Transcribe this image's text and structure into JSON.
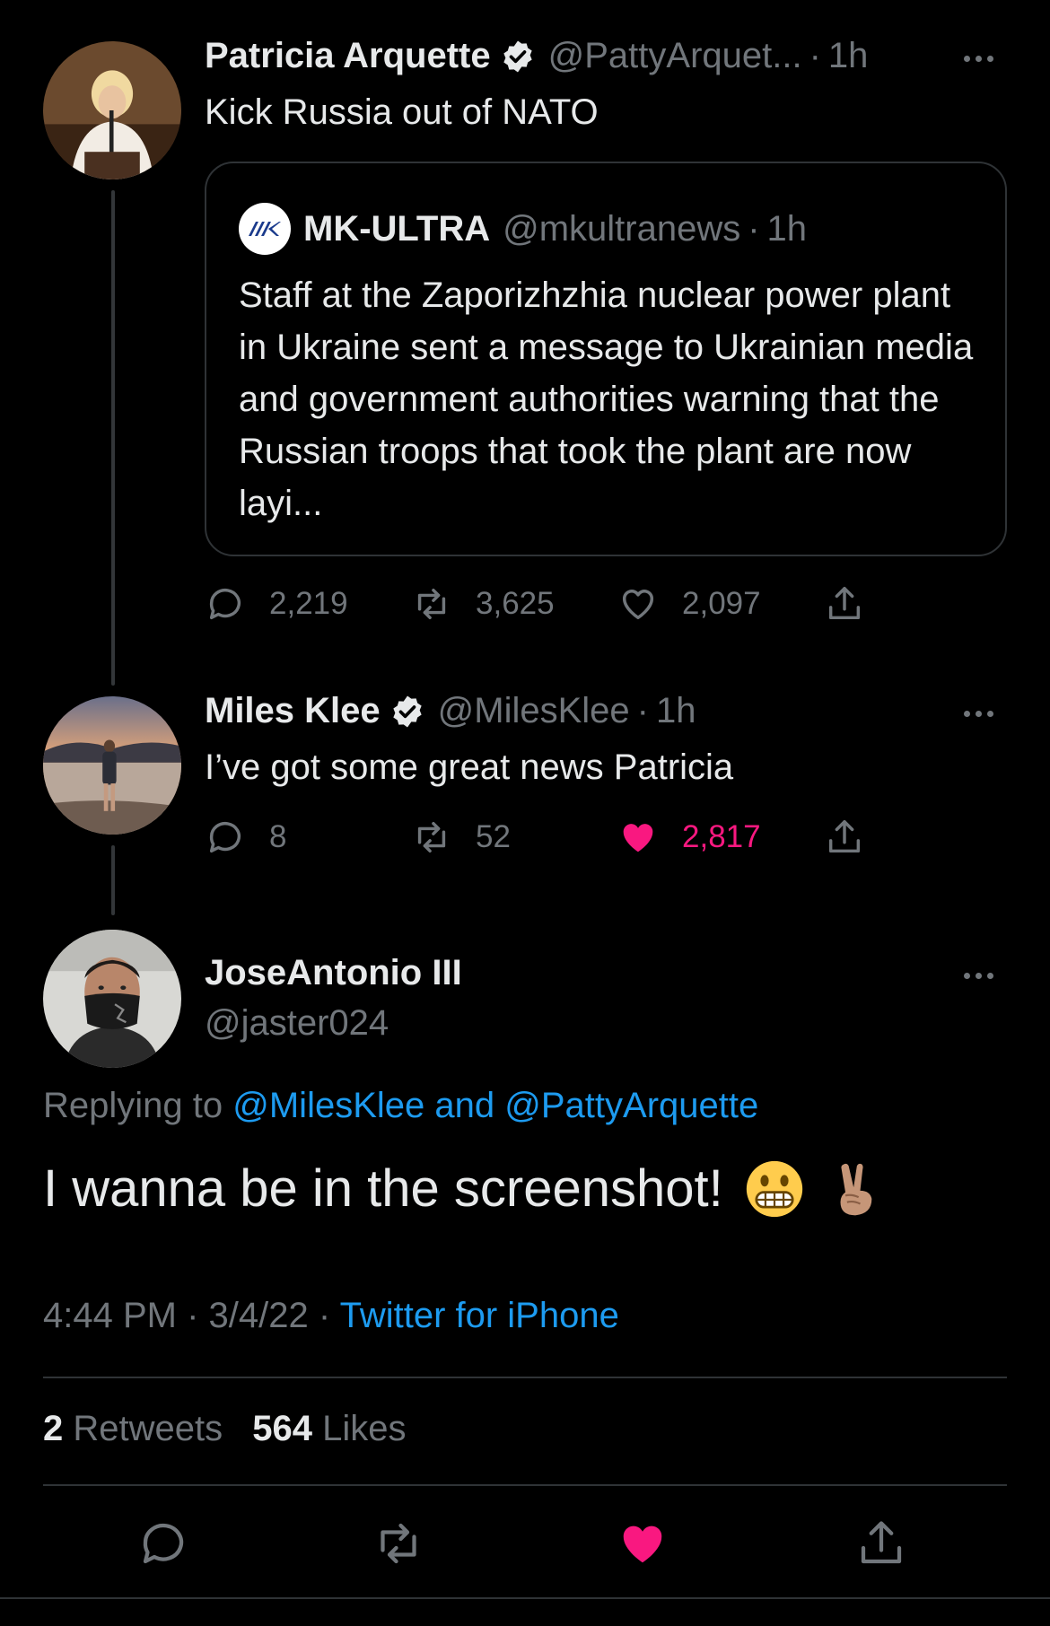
{
  "thread": {
    "tweet1": {
      "name": "Patricia Arquette",
      "handle": "@PattyArquet...",
      "time": "1h",
      "text": "Kick Russia out of NATO",
      "quote": {
        "name": "MK-ULTRA",
        "handle": "@mkultranews",
        "time": "1h",
        "text": "Staff at the Zaporizhzhia nuclear power plant in Ukraine sent a message to Ukrainian media and government authorities warning that the Russian troops that took the plant are now layi..."
      },
      "replies": "2,219",
      "retweets": "3,625",
      "likes": "2,097"
    },
    "tweet2": {
      "name": "Miles Klee",
      "handle": "@MilesKlee",
      "time": "1h",
      "text": "I’ve got some great news Patricia",
      "replies": "8",
      "retweets": "52",
      "likes": "2,817"
    },
    "main": {
      "name": "JoseAntonio III",
      "handle": "@jaster024",
      "replying_prefix": "Replying to",
      "replying_user1": "@MilesKlee",
      "replying_and": "and",
      "replying_user2": "@PattyArquette",
      "text": "I wanna be in the screenshot!",
      "time": "4:44 PM",
      "date": "3/4/22",
      "source": "Twitter for iPhone",
      "retweets_count": "2",
      "retweets_label": "Retweets",
      "likes_count": "564",
      "likes_label": "Likes"
    }
  },
  "colors": {
    "background": "#000000",
    "text": "#e7e9ea",
    "muted": "#71767b",
    "link": "#1d9bf0",
    "like": "#f91880",
    "border": "#2f3336"
  },
  "icons": [
    "verified-badge-icon",
    "more-icon",
    "reply-icon",
    "retweet-icon",
    "like-icon",
    "share-icon",
    "grimacing-emoji-icon",
    "victory-hand-emoji-icon"
  ]
}
